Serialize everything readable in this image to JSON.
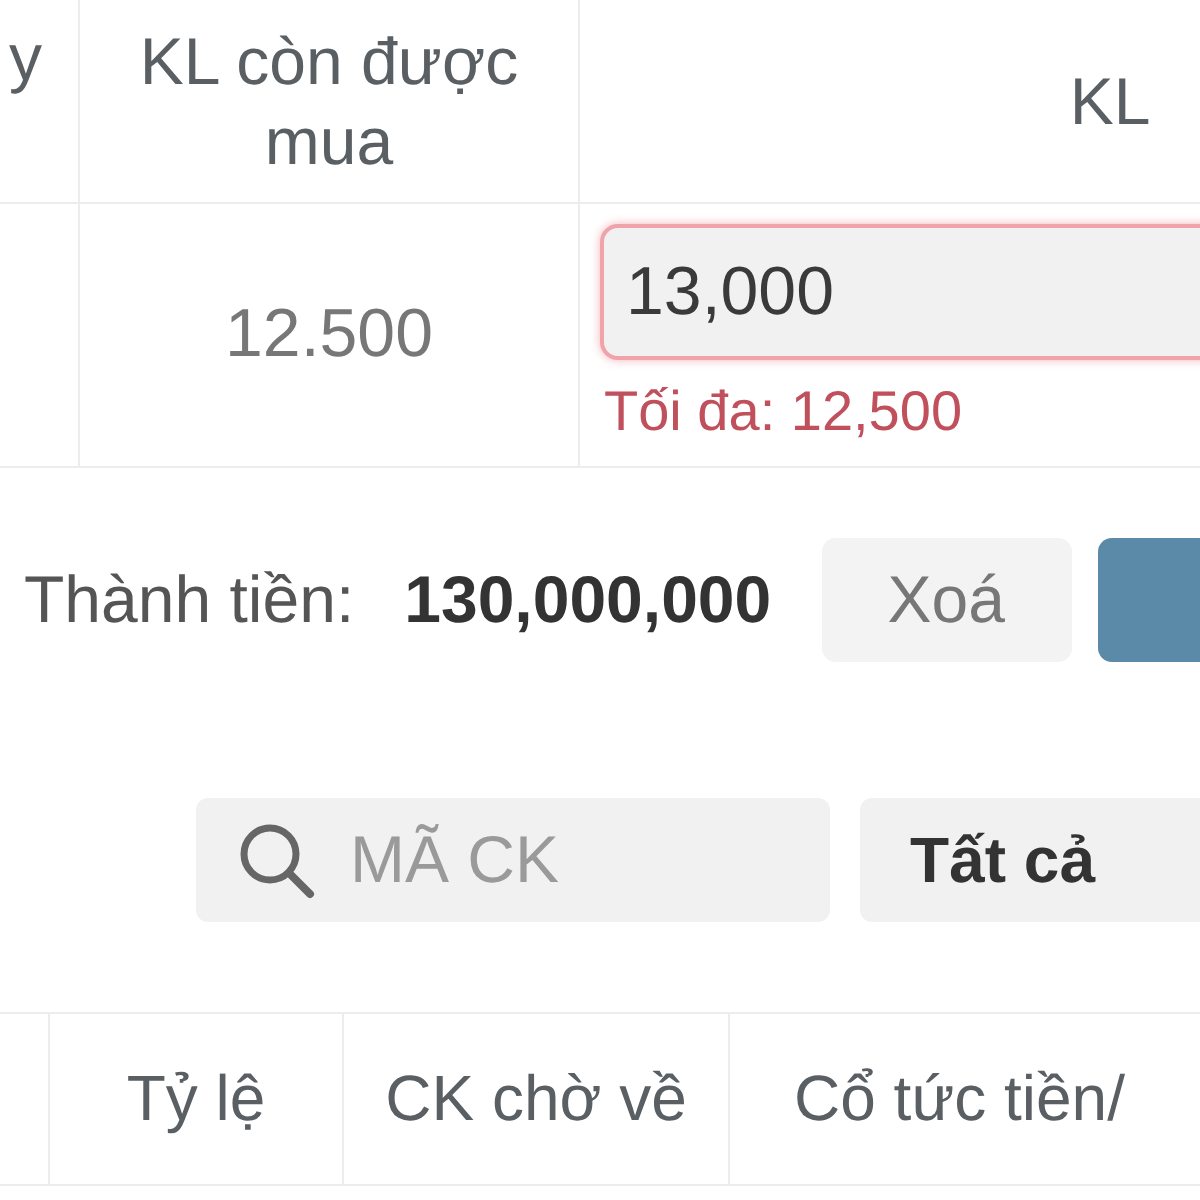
{
  "top_table": {
    "columns": [
      "y",
      "KL còn được mua",
      "KL"
    ],
    "row": {
      "remaining": "12.500",
      "quantity_input": {
        "value": "13,000",
        "invalid": true,
        "error": "Tối đa: 12,500"
      }
    }
  },
  "summary": {
    "label": "Thành tiền:",
    "total": "130,000,000",
    "buttons": [
      {
        "kind": "secondary",
        "label": "Xoá"
      },
      {
        "kind": "primary"
      }
    ]
  },
  "filters": {
    "search": {
      "placeholder": "MÃ CK"
    },
    "select": {
      "value": "Tất cả"
    }
  },
  "bottom_table": {
    "columns": [
      "Tỷ lệ",
      "CK chờ về",
      "Cổ tức tiền/"
    ]
  }
}
